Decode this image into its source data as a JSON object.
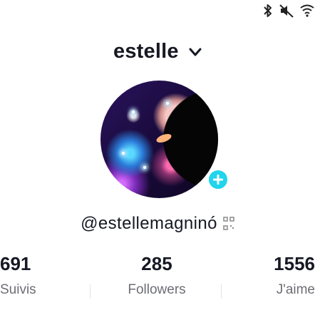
{
  "status_bar": {
    "icons": [
      "bluetooth-icon",
      "mute-icon",
      "wifi-icon"
    ]
  },
  "profile": {
    "account_name": "estelle",
    "handle": "@estellemagninó",
    "stats": [
      {
        "value": "691",
        "label": "Suivis"
      },
      {
        "value": "285",
        "label": "Followers"
      },
      {
        "value": "1556",
        "label": "J'aime"
      }
    ]
  },
  "colors": {
    "accent": "#20d5ec",
    "text": "#161823",
    "muted": "#6d6e75"
  }
}
